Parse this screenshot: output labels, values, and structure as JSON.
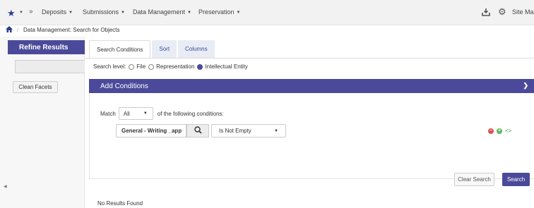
{
  "colors": {
    "accent": "#4b4a9a",
    "topnav_bg": "#f2f2f2",
    "sidebar_bg": "#f7f7f7",
    "danger": "#d9534f",
    "success": "#5cb85c"
  },
  "topnav": {
    "icons": [
      "star-icon",
      "chevron-double-right-icon",
      "download-icon",
      "gear-icon"
    ],
    "items": [
      {
        "label": "Deposits"
      },
      {
        "label": "Submissions"
      },
      {
        "label": "Data Management"
      },
      {
        "label": "Preservation"
      }
    ],
    "site_map": "Site Map"
  },
  "breadcrumb": {
    "separator": "/",
    "current": "Data Management: Search for Objects"
  },
  "sidebar": {
    "title": "Refine Results",
    "clean_facets": "Clean Facets"
  },
  "main": {
    "tabs": [
      {
        "label": "Search Conditions",
        "active": true
      },
      {
        "label": "Sort",
        "active": false
      },
      {
        "label": "Columns",
        "active": false
      }
    ],
    "search_level": {
      "label": "Search level:",
      "options": [
        {
          "label": "File",
          "checked": false
        },
        {
          "label": "Representation",
          "checked": false
        },
        {
          "label": "Intellectual Entity",
          "checked": true
        }
      ]
    },
    "add_conditions": "Add Conditions",
    "match": {
      "prefix": "Match",
      "selected": "All",
      "suffix": "of the following conditions:"
    },
    "condition": {
      "field_value": "General - Writing _app",
      "operator": "Is Not Empty"
    },
    "buttons": {
      "clear": "Clear Search",
      "search": "Search"
    },
    "results_text": "No Results Found"
  }
}
